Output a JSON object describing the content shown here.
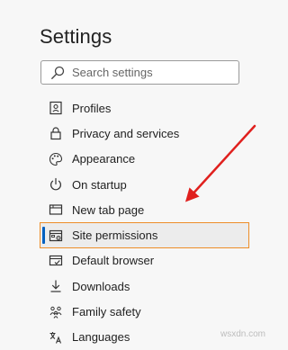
{
  "settings": {
    "title": "Settings",
    "search_placeholder": "Search settings"
  },
  "nav": {
    "items": [
      {
        "label": "Profiles",
        "icon": "profile-card-icon",
        "selected": false
      },
      {
        "label": "Privacy and services",
        "icon": "lock-icon",
        "selected": false
      },
      {
        "label": "Appearance",
        "icon": "palette-icon",
        "selected": false
      },
      {
        "label": "On startup",
        "icon": "power-icon",
        "selected": false
      },
      {
        "label": "New tab page",
        "icon": "new-tab-icon",
        "selected": false
      },
      {
        "label": "Site permissions",
        "icon": "site-permissions-icon",
        "selected": true
      },
      {
        "label": "Default browser",
        "icon": "browser-icon",
        "selected": false
      },
      {
        "label": "Downloads",
        "icon": "download-icon",
        "selected": false
      },
      {
        "label": "Family safety",
        "icon": "family-icon",
        "selected": false
      },
      {
        "label": "Languages",
        "icon": "language-icon",
        "selected": false
      }
    ]
  },
  "annotation": {
    "highlight_color": "#ed8d28",
    "arrow_color": "#e0201e"
  },
  "watermark": "wsxdn.com"
}
